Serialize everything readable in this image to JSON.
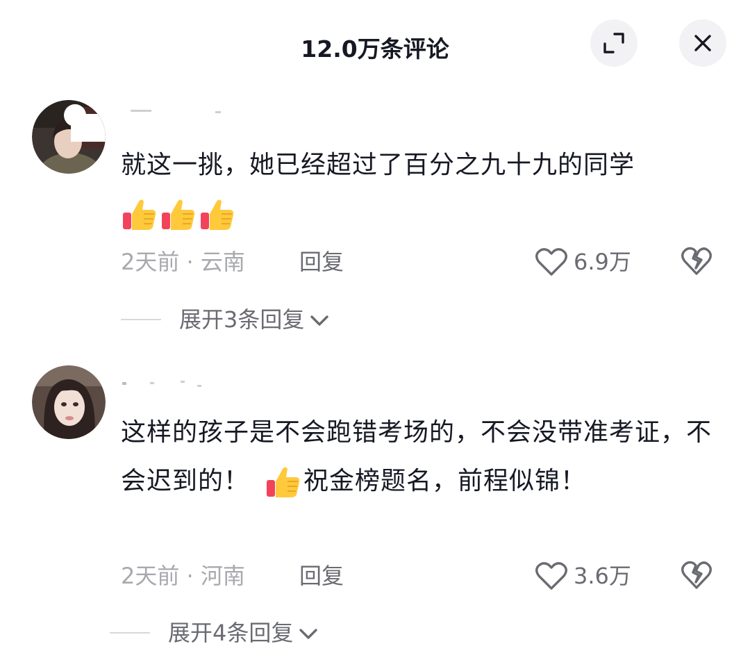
{
  "header": {
    "title": "12.0万条评论",
    "expand_icon": "expand-icon",
    "close_icon": "close-icon"
  },
  "comments": [
    {
      "text": "就这一挑，她已经超过了百分之九十九的同学",
      "emoji_count": 3,
      "emoji_icon": "thumbs-up-icon",
      "time_location": "2天前 · 云南",
      "reply_label": "回复",
      "like_count": "6.9万",
      "expand_label": "展开3条回复"
    },
    {
      "text_part1": "这样的孩子是不会跑错考场的，不会没带准考证，不会迟到的！",
      "text_part2": "祝金榜题名，前程似锦！",
      "emoji_icon": "thumbs-up-icon",
      "time_location": "2天前 · 河南",
      "reply_label": "回复",
      "like_count": "3.6万",
      "expand_label": "展开4条回复"
    }
  ],
  "colors": {
    "primary_text": "#161823",
    "secondary_text": "#6a6b72",
    "muted_text": "#a8a9ae",
    "button_bg": "#f2f2f4"
  }
}
